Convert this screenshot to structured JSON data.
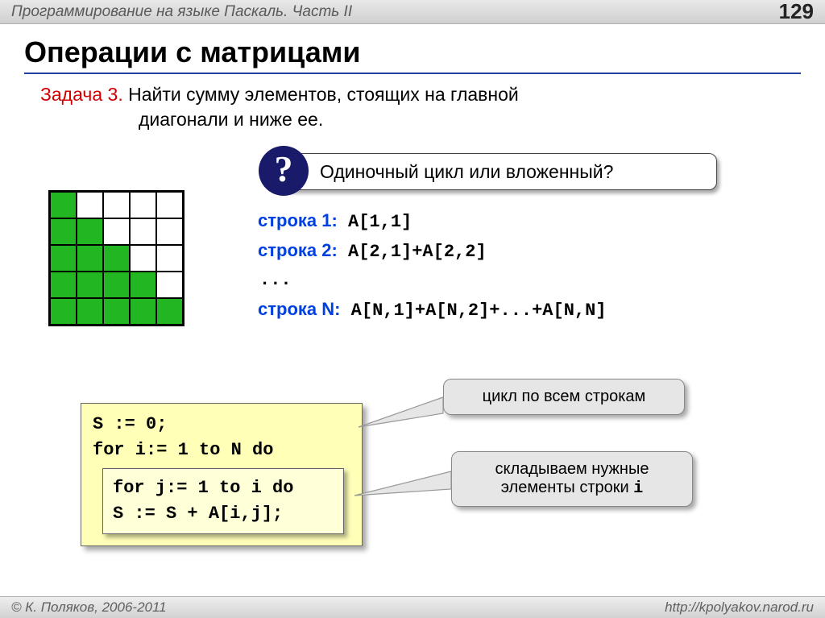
{
  "header": {
    "title": "Программирование на языке Паскаль. Часть II",
    "page": "129"
  },
  "slide": {
    "title": "Операции с матрицами"
  },
  "task": {
    "label": "Задача 3.",
    "text1": " Найти сумму элементов, стоящих  на главной",
    "text2": "диагонали и ниже ее."
  },
  "callout": {
    "question_symbol": "?",
    "text": "Одиночный цикл или вложенный?"
  },
  "matrix": {
    "fill": [
      [
        1,
        0,
        0,
        0,
        0
      ],
      [
        1,
        1,
        0,
        0,
        0
      ],
      [
        1,
        1,
        1,
        0,
        0
      ],
      [
        1,
        1,
        1,
        1,
        0
      ],
      [
        1,
        1,
        1,
        1,
        1
      ]
    ]
  },
  "rows": {
    "r1": {
      "label": "строка 1:",
      "code": " A[1,1]"
    },
    "r2": {
      "label": "строка 2:",
      "code": " A[2,1]+A[2,2]"
    },
    "dots": "...",
    "rN": {
      "label": "строка N:",
      "code": " A[N,1]+A[N,2]+...+A[N,N]"
    }
  },
  "code": {
    "l1": "S := 0;",
    "l2": "for i:= 1 to N do",
    "l3": "for j:= 1 to i do",
    "l4": "  S := S + A[i,j];"
  },
  "annotations": {
    "a1": "цикл по всем строкам",
    "a2_prefix": "складываем нужные элементы строки ",
    "a2_mono": "i"
  },
  "footer": {
    "copyright": "© К. Поляков, 2006-2011",
    "url": "http://kpolyakov.narod.ru"
  }
}
